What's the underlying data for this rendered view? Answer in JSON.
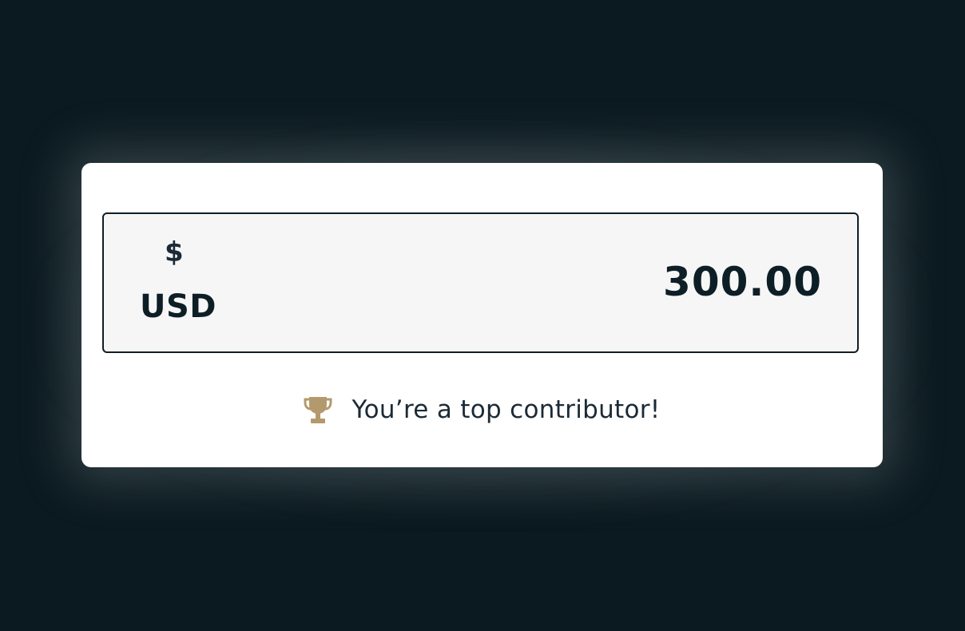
{
  "colors": {
    "background": "#0b1a20",
    "card": "#ffffff",
    "input_background": "#f6f6f7",
    "input_border": "#0e1e26",
    "text_primary": "#0e1e26",
    "trophy": "#b39a6e"
  },
  "amount_input": {
    "currency_symbol": "$",
    "currency_code": "USD",
    "value": "300.00"
  },
  "badge": {
    "icon": "trophy-icon",
    "text": "You’re a top contributor!"
  }
}
